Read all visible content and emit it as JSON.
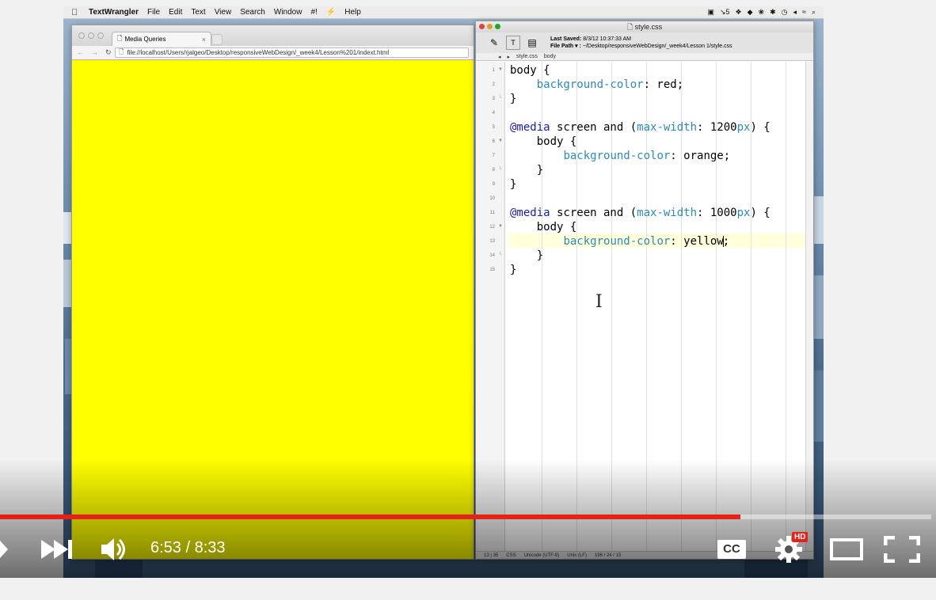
{
  "menubar": {
    "app_name": "TextWrangler",
    "items": [
      "File",
      "Edit",
      "Text",
      "View",
      "Search",
      "Window",
      "#!",
      "Help"
    ],
    "tray_count": "5"
  },
  "browser": {
    "tab_title": "Media Queries",
    "url": "file://localhost/Users/rjalgeo/Desktop/responsiveWebDesign/_week4/Lesson%201/indext.html",
    "page_background": "#ffff00"
  },
  "editor": {
    "window_title": "style.css",
    "last_saved_label": "Last Saved:",
    "last_saved_value": "8/3/12 10:37:33 AM",
    "file_path_label": "File Path ▾ :",
    "file_path_value": "~/Desktop/responsiveWebDesign/_week4/Lesson 1/style.css",
    "nav_file": "style.css",
    "nav_symbol": "body",
    "status": {
      "position": "13 | 35",
      "language": "CSS",
      "encoding": "Unicode (UTF-8)",
      "line_endings": "Unix (LF)",
      "counts": "196 / 24 / 15"
    },
    "lines": [
      {
        "n": "1",
        "fold": "▼",
        "parts": [
          {
            "t": "body {",
            "c": ""
          }
        ]
      },
      {
        "n": "2",
        "fold": "",
        "parts": [
          {
            "t": "    ",
            "c": ""
          },
          {
            "t": "background-color",
            "c": "prop"
          },
          {
            "t": ": red;",
            "c": ""
          }
        ]
      },
      {
        "n": "3",
        "fold": "└",
        "parts": [
          {
            "t": "}",
            "c": ""
          }
        ]
      },
      {
        "n": "4",
        "fold": "",
        "parts": []
      },
      {
        "n": "5",
        "fold": "",
        "parts": [
          {
            "t": "@media",
            "c": "kw"
          },
          {
            "t": " screen and (",
            "c": ""
          },
          {
            "t": "max-width",
            "c": "prop"
          },
          {
            "t": ": 1200",
            "c": ""
          },
          {
            "t": "px",
            "c": "prop"
          },
          {
            "t": ") {",
            "c": ""
          }
        ]
      },
      {
        "n": "6",
        "fold": "▼",
        "parts": [
          {
            "t": "    body {",
            "c": ""
          }
        ]
      },
      {
        "n": "7",
        "fold": "",
        "parts": [
          {
            "t": "        ",
            "c": ""
          },
          {
            "t": "background-color",
            "c": "prop"
          },
          {
            "t": ": orange;",
            "c": ""
          }
        ]
      },
      {
        "n": "8",
        "fold": "└",
        "parts": [
          {
            "t": "    }",
            "c": ""
          }
        ]
      },
      {
        "n": "9",
        "fold": "",
        "parts": [
          {
            "t": "}",
            "c": ""
          }
        ]
      },
      {
        "n": "10",
        "fold": "",
        "parts": []
      },
      {
        "n": "11",
        "fold": "",
        "parts": [
          {
            "t": "@media",
            "c": "kw"
          },
          {
            "t": " screen and (",
            "c": ""
          },
          {
            "t": "max-width",
            "c": "prop"
          },
          {
            "t": ": 1000",
            "c": ""
          },
          {
            "t": "px",
            "c": "prop"
          },
          {
            "t": ") {",
            "c": ""
          }
        ]
      },
      {
        "n": "12",
        "fold": "▼",
        "parts": [
          {
            "t": "    body {",
            "c": ""
          }
        ]
      },
      {
        "n": "13",
        "fold": "",
        "parts": [
          {
            "t": "        ",
            "c": ""
          },
          {
            "t": "background-color",
            "c": "prop"
          },
          {
            "t": ": yellow",
            "c": ""
          },
          {
            "t": "|",
            "c": "cursor"
          },
          {
            "t": ";",
            "c": ""
          }
        ]
      },
      {
        "n": "14",
        "fold": "└",
        "parts": [
          {
            "t": "    }",
            "c": ""
          }
        ]
      },
      {
        "n": "15",
        "fold": "",
        "parts": [
          {
            "t": "}",
            "c": ""
          }
        ]
      }
    ],
    "highlighted_line": "13"
  },
  "player": {
    "time": "6:53 / 8:33",
    "progress": 0.795,
    "cc_label": "CC",
    "hd_badge": "HD",
    "colors": {
      "accent": "#e62117"
    }
  }
}
